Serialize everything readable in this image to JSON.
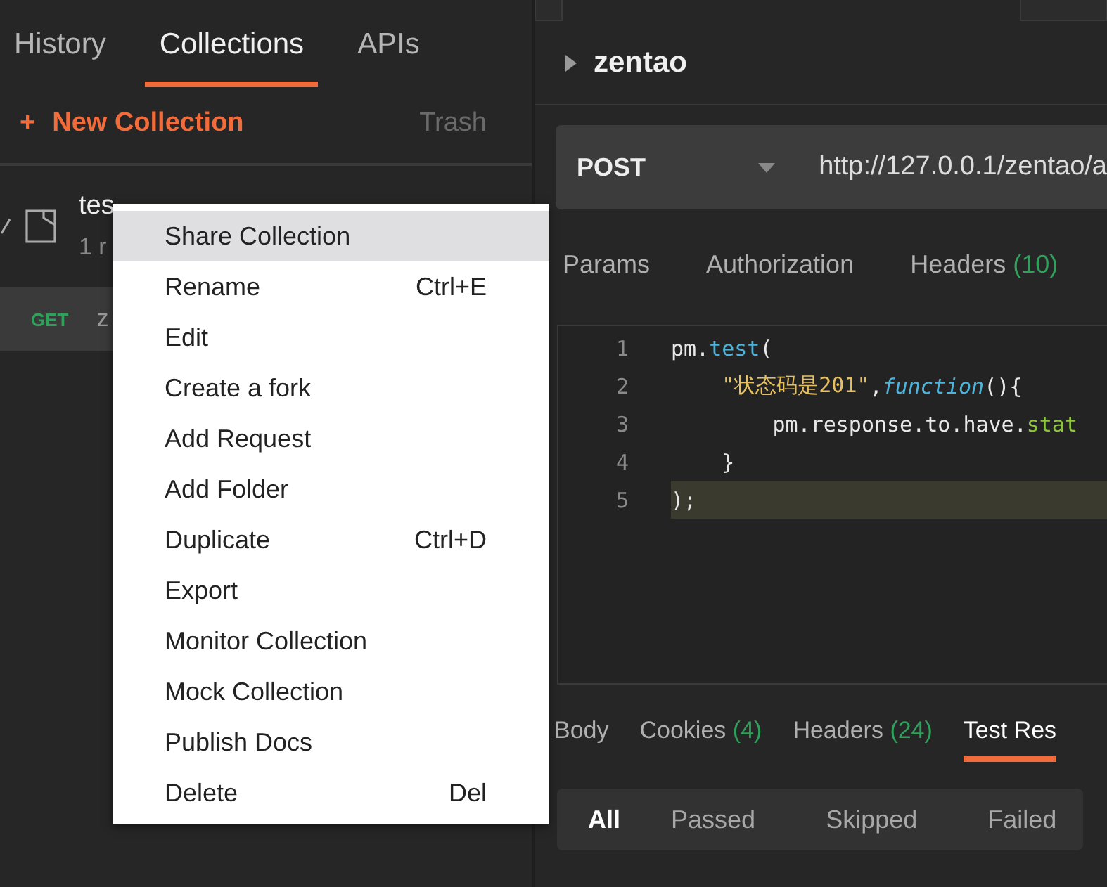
{
  "sidebar": {
    "tabs": [
      {
        "label": "History",
        "selected": false
      },
      {
        "label": "Collections",
        "selected": true
      },
      {
        "label": "APIs",
        "selected": false
      }
    ],
    "new_collection": {
      "icon": "+",
      "label": "New Collection"
    },
    "trash": "Trash",
    "collection": {
      "expanded": true,
      "name": "tes",
      "meta": "1 r"
    },
    "request": {
      "method": "GET",
      "name": "z"
    }
  },
  "context_menu": [
    {
      "label": "Share Collection",
      "selected": true
    },
    {
      "label": "Rename",
      "shortcut": "Ctrl+E",
      "selected": false
    },
    {
      "label": "Edit",
      "selected": false
    },
    {
      "label": "Create a fork",
      "selected": false
    },
    {
      "label": "Add Request",
      "selected": false
    },
    {
      "label": "Add Folder",
      "selected": false
    },
    {
      "label": "Duplicate",
      "shortcut": "Ctrl+D",
      "selected": false
    },
    {
      "label": "Export",
      "selected": false
    },
    {
      "label": "Monitor Collection",
      "selected": false
    },
    {
      "label": "Mock Collection",
      "selected": false
    },
    {
      "label": "Publish Docs",
      "selected": false
    },
    {
      "label": "Delete",
      "shortcut": "Del",
      "selected": false
    }
  ],
  "request_title": "zentao",
  "url_bar": {
    "method": "POST",
    "url": "http://127.0.0.1/zentao/a"
  },
  "request_tabs": [
    {
      "label": "Params"
    },
    {
      "label": "Authorization"
    },
    {
      "label": "Headers",
      "count": "(10)"
    }
  ],
  "editor": {
    "lines": [
      {
        "number": "1",
        "highlighted": false,
        "tokens": [
          {
            "kind": "plain",
            "text": "pm."
          },
          {
            "kind": "method",
            "text": "test"
          },
          {
            "kind": "plain",
            "text": "("
          }
        ]
      },
      {
        "number": "2",
        "highlighted": false,
        "tokens": [
          {
            "kind": "string",
            "text": "    \"状态码是201\""
          },
          {
            "kind": "plain",
            "text": ","
          },
          {
            "kind": "keyword",
            "text": "function"
          },
          {
            "kind": "plain",
            "text": "(){"
          }
        ]
      },
      {
        "number": "3",
        "highlighted": false,
        "tokens": [
          {
            "kind": "plain",
            "text": "        pm.response.to.have."
          },
          {
            "kind": "property",
            "text": "stat"
          }
        ]
      },
      {
        "number": "4",
        "highlighted": false,
        "tokens": [
          {
            "kind": "plain",
            "text": "    }"
          }
        ]
      },
      {
        "number": "5",
        "highlighted": true,
        "tokens": [
          {
            "kind": "plain",
            "text": ");"
          }
        ]
      }
    ]
  },
  "response_tabs": [
    {
      "label": "Body",
      "selected": false
    },
    {
      "label": "Cookies",
      "count": "(4)",
      "selected": false
    },
    {
      "label": "Headers",
      "count": "(24)",
      "selected": false
    },
    {
      "label": "Test Res",
      "selected": true
    }
  ],
  "result_filters": [
    {
      "label": "All",
      "selected": true
    },
    {
      "label": "Passed",
      "selected": false
    },
    {
      "label": "Skipped",
      "selected": false
    },
    {
      "label": "Failed",
      "selected": false
    }
  ]
}
